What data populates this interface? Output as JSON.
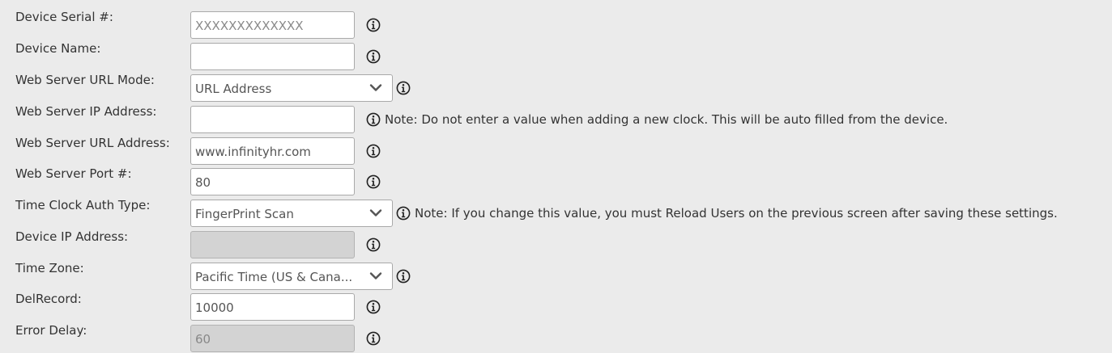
{
  "form": {
    "rows": [
      {
        "label": "Device Serial #:",
        "value": "XXXXXXXXXXXXX",
        "kind": "text",
        "value_style": "placeholder"
      },
      {
        "label": "Device Name:",
        "value": "",
        "kind": "text"
      },
      {
        "label": "Web Server URL Mode:",
        "value": "URL Address",
        "kind": "select"
      },
      {
        "label": "Web Server IP Address:",
        "value": "",
        "kind": "text",
        "note": "Note: Do not enter a value when adding a new clock. This will be auto filled from the device."
      },
      {
        "label": "Web Server URL Address:",
        "value": "www.infinityhr.com",
        "kind": "text"
      },
      {
        "label": "Web Server Port #:",
        "value": "80",
        "kind": "text"
      },
      {
        "label": "Time Clock Auth Type:",
        "value": "FingerPrint Scan",
        "kind": "select",
        "note": "Note: If you change this value, you must Reload Users on the previous screen after saving these settings."
      },
      {
        "label": "Device IP Address:",
        "value": "",
        "kind": "text",
        "disabled": true
      },
      {
        "label": "Time Zone:",
        "value": "Pacific Time (US & Cana...",
        "kind": "select"
      },
      {
        "label": "DelRecord:",
        "value": "10000",
        "kind": "text"
      },
      {
        "label": "Error Delay:",
        "value": "60",
        "kind": "text",
        "disabled": true
      }
    ]
  },
  "icons": {
    "info": "info-circle-icon",
    "dropdown": "chevron-down-icon"
  },
  "colors": {
    "background": "#ebebeb",
    "field_border": "#a9a9a9",
    "disabled_field": "#d3d3d3",
    "text": "#333333"
  }
}
